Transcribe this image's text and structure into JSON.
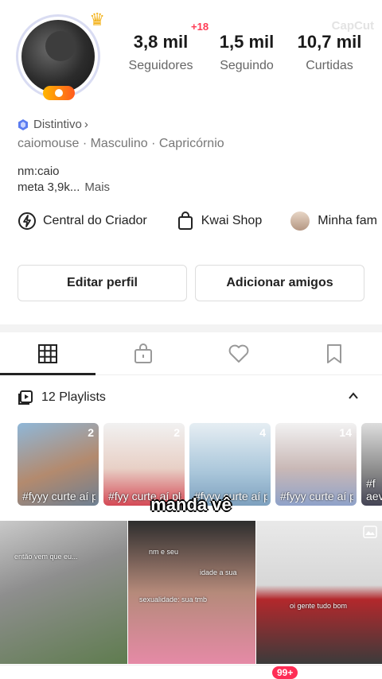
{
  "watermark": "CapCut",
  "profile": {
    "plus18": "+18",
    "stats": [
      {
        "value": "3,8 mil",
        "label": "Seguidores"
      },
      {
        "value": "1,5 mil",
        "label": "Seguindo"
      },
      {
        "value": "10,7 mil",
        "label": "Curtidas"
      }
    ],
    "badge": "Distintivo",
    "badge_chevron": "›",
    "meta": "caiomouse · Masculino · Capricórnio",
    "bio_line1": "nm:caio",
    "bio_line2": "meta 3,9k...",
    "more": "Mais"
  },
  "shortcuts": {
    "creator": "Central do Criador",
    "shop": "Kwai Shop",
    "family": "Minha fam"
  },
  "buttons": {
    "edit": "Editar perfil",
    "add": "Adicionar amigos"
  },
  "tabs": [
    "grid-icon",
    "lock-bag-icon",
    "heart-icon",
    "bookmark-icon"
  ],
  "playlists": {
    "header": "12 Playlists",
    "items": [
      {
        "count": "2",
        "title": "#fyyy curte aí plss pra não ..."
      },
      {
        "count": "2",
        "title": "#fyy curte aí plss"
      },
      {
        "count": "4",
        "title": "#fyyy curte aí por favor"
      },
      {
        "count": "14",
        "title": "#fyyy curte aí plss"
      },
      {
        "count": "",
        "title": "#f aev"
      }
    ]
  },
  "caption": "manda vê",
  "videos": [
    {
      "text1": "então vem que eu..."
    },
    {
      "text1": "nm e seu",
      "text2": "idade a sua",
      "text3": "sexualidade: sua tmb"
    },
    {
      "text1": "oi gente tudo bom"
    }
  ],
  "bottom_nav": {
    "badge": "99+"
  },
  "colors": {
    "accent": "#ff2d55",
    "badge_blue": "#5b7cf0"
  }
}
